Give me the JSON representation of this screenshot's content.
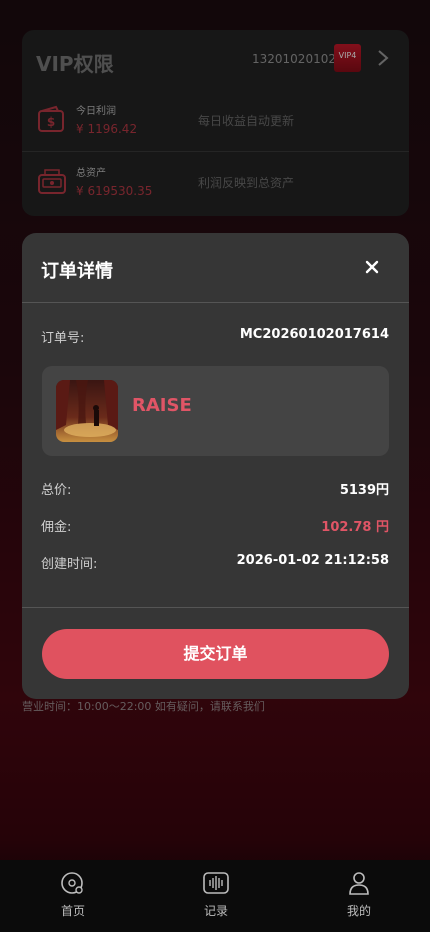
{
  "vip": {
    "title": "VIP权限",
    "user_id": "132010201023",
    "badge_label": "VIP4",
    "rows": [
      {
        "label": "今日利润",
        "value": "¥ 1196.42",
        "note": "每日收益自动更新"
      },
      {
        "label": "总资产",
        "value": "¥ 619530.35",
        "note": "利润反映到总资产"
      }
    ]
  },
  "business_hours": "营业时间：10:00～22:00 如有疑问，请联系我们",
  "modal": {
    "title": "订单详情",
    "order_label": "订单号:",
    "order_no": "MC20260102017614",
    "product_name": "RAISE",
    "total_label": "总价:",
    "total_value": "5139円",
    "commission_label": "佣金:",
    "commission_value": "102.78 円",
    "created_label": "创建时间:",
    "created_value": "2026-01-02 21:12:58",
    "submit_label": "提交订单"
  },
  "nav": {
    "items": [
      {
        "label": "首页",
        "icon": "home-icon"
      },
      {
        "label": "记录",
        "icon": "record-icon"
      },
      {
        "label": "我的",
        "icon": "profile-icon"
      }
    ]
  },
  "colors": {
    "accent": "#e0525f",
    "value_red": "#b83a45",
    "modal_bg": "#363636",
    "card_bg": "#242424"
  }
}
